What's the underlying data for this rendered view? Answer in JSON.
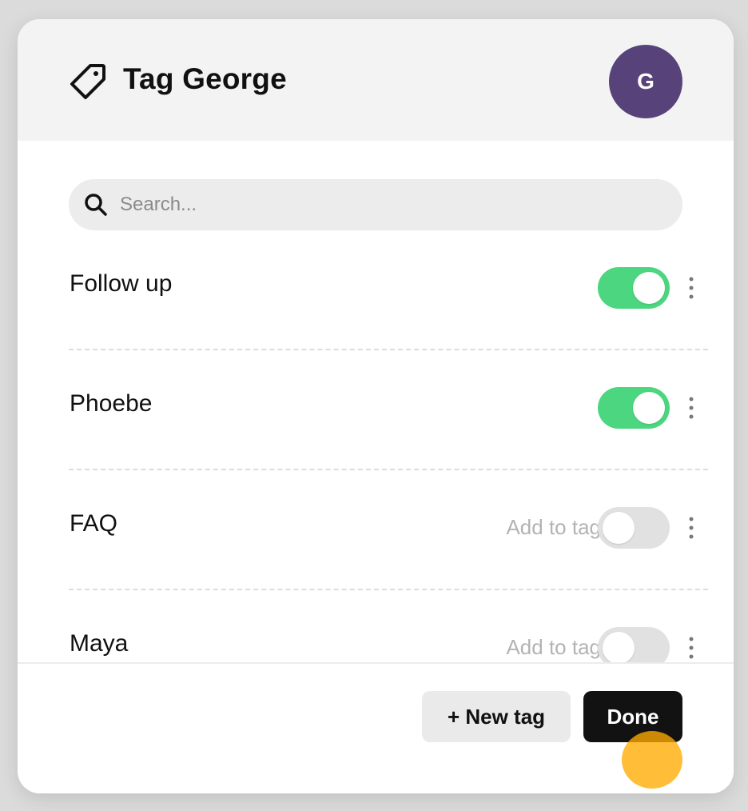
{
  "modal": {
    "title": "Tag George",
    "avatar_initial": "G",
    "avatar_color": "#57437a"
  },
  "search": {
    "placeholder": "Search..."
  },
  "tags": [
    {
      "name": "Follow up",
      "enabled": true,
      "hint": ""
    },
    {
      "name": "Phoebe",
      "enabled": true,
      "hint": ""
    },
    {
      "name": "FAQ",
      "enabled": false,
      "hint": "Add to tag"
    },
    {
      "name": "Maya",
      "enabled": false,
      "hint": "Add to tag"
    }
  ],
  "footer": {
    "new_tag_label": "+ New tag",
    "done_label": "Done"
  },
  "colors": {
    "toggle_on": "#4cd67f",
    "toggle_off": "#e1e1e1",
    "cursor_highlight": "#ffaa00"
  },
  "icons": {
    "header": "tag-icon",
    "search": "search-icon",
    "row_menu": "more-vertical-icon"
  }
}
